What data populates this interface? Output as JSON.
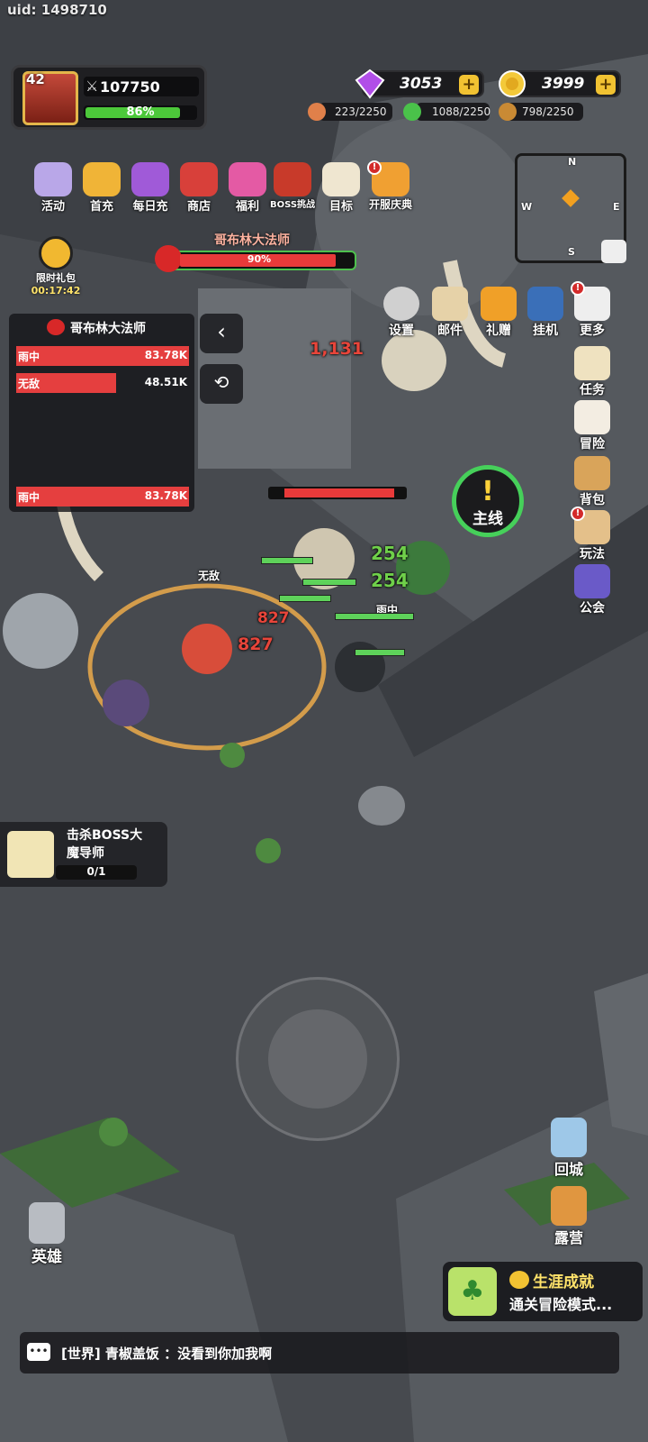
{
  "uid": "uid: 1498710",
  "player": {
    "level": "42",
    "power": "107750",
    "exp_percent": 86,
    "exp_label": "86%"
  },
  "currency": {
    "gems": "3053",
    "gold": "3999"
  },
  "resources": {
    "food": "223/2250",
    "leaf": "1088/2250",
    "wood": "798/2250"
  },
  "top_icons": [
    "活动",
    "首充",
    "每日充",
    "商店",
    "福利",
    "BOSS挑战",
    "目标",
    "开服庆典"
  ],
  "gift": {
    "label": "限时礼包",
    "timer": "00:17:42"
  },
  "boss": {
    "name": "哥布林大法师",
    "hp_percent": 90,
    "hp_label": "90%"
  },
  "damage_panel": {
    "title": "哥布林大法师",
    "rows": [
      {
        "name": "雨中",
        "value": "83.78K",
        "fill": 1.0
      },
      {
        "name": "无敌",
        "value": "48.51K",
        "fill": 0.58
      },
      {
        "name": "雨中",
        "value": "83.78K",
        "fill": 1.0
      }
    ]
  },
  "mini_map": {
    "n": "N",
    "e": "E",
    "s": "S",
    "w": "W"
  },
  "menu_row": [
    "设置",
    "邮件",
    "礼赠",
    "挂机",
    "更多"
  ],
  "right_col": [
    "任务",
    "冒险",
    "背包",
    "玩法",
    "公会"
  ],
  "quest_label": "主线",
  "task": {
    "line1": "击杀BOSS大",
    "line2": "魔导师",
    "progress": "0/1"
  },
  "bottom_right": [
    "回城",
    "露营"
  ],
  "hero_label": "英雄",
  "achievement": {
    "title": "生涯成就",
    "desc": "通关冒险模式..."
  },
  "chat": {
    "text": "[世界] 青椒盖饭 ：没看到你加我啊"
  },
  "battle_text": {
    "dmg1": "254",
    "dmg2": "254",
    "hit1": "827",
    "hit2": "827",
    "hit3": "1,131",
    "tag1": "无敌",
    "tag2": "雨中"
  },
  "colors": {
    "hp_red": "#e83a3a",
    "exp_green": "#4cc83a",
    "gold": "#f1c232"
  }
}
